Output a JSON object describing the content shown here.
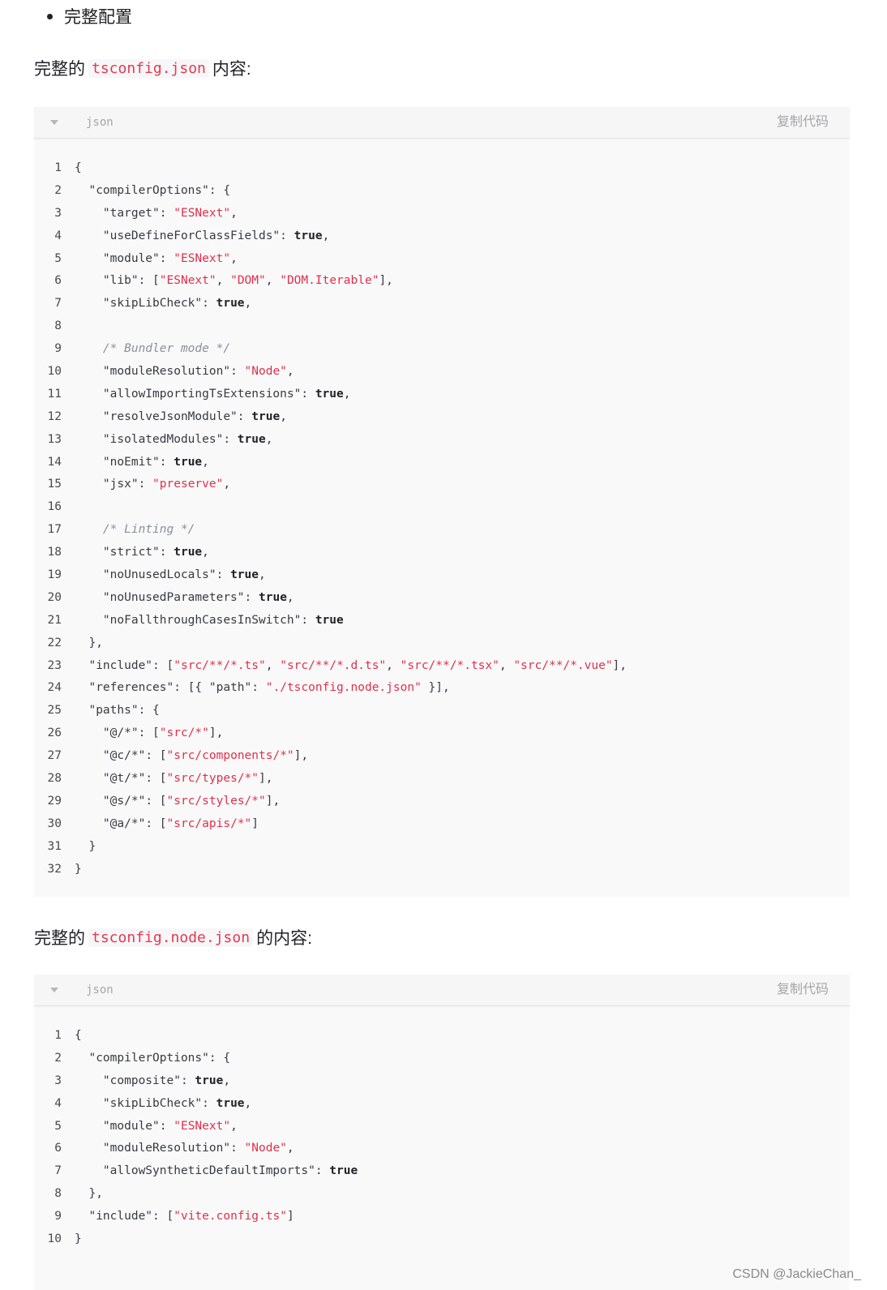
{
  "bullet": "完整配置",
  "section1": {
    "prefix": "完整的",
    "code": "tsconfig.json",
    "suffix": "内容:"
  },
  "section2": {
    "prefix": "完整的",
    "code": "tsconfig.node.json",
    "suffix": "的内容:"
  },
  "block1": {
    "lang": "json",
    "copy_label": "复制代码",
    "lines": [
      [
        [
          "p",
          "{"
        ]
      ],
      [
        [
          "p",
          "  "
        ],
        [
          "k",
          "\"compilerOptions\""
        ],
        [
          "p",
          ": {"
        ]
      ],
      [
        [
          "p",
          "    "
        ],
        [
          "k",
          "\"target\""
        ],
        [
          "p",
          ": "
        ],
        [
          "s",
          "\"ESNext\""
        ],
        [
          "p",
          ","
        ]
      ],
      [
        [
          "p",
          "    "
        ],
        [
          "k",
          "\"useDefineForClassFields\""
        ],
        [
          "p",
          ": "
        ],
        [
          "b",
          "true"
        ],
        [
          "p",
          ","
        ]
      ],
      [
        [
          "p",
          "    "
        ],
        [
          "k",
          "\"module\""
        ],
        [
          "p",
          ": "
        ],
        [
          "s",
          "\"ESNext\""
        ],
        [
          "p",
          ","
        ]
      ],
      [
        [
          "p",
          "    "
        ],
        [
          "k",
          "\"lib\""
        ],
        [
          "p",
          ": ["
        ],
        [
          "s",
          "\"ESNext\""
        ],
        [
          "p",
          ", "
        ],
        [
          "s",
          "\"DOM\""
        ],
        [
          "p",
          ", "
        ],
        [
          "s",
          "\"DOM.Iterable\""
        ],
        [
          "p",
          "],"
        ]
      ],
      [
        [
          "p",
          "    "
        ],
        [
          "k",
          "\"skipLibCheck\""
        ],
        [
          "p",
          ": "
        ],
        [
          "b",
          "true"
        ],
        [
          "p",
          ","
        ]
      ],
      [
        [
          "p",
          ""
        ]
      ],
      [
        [
          "p",
          "    "
        ],
        [
          "c",
          "/* Bundler mode */"
        ]
      ],
      [
        [
          "p",
          "    "
        ],
        [
          "k",
          "\"moduleResolution\""
        ],
        [
          "p",
          ": "
        ],
        [
          "s",
          "\"Node\""
        ],
        [
          "p",
          ","
        ]
      ],
      [
        [
          "p",
          "    "
        ],
        [
          "k",
          "\"allowImportingTsExtensions\""
        ],
        [
          "p",
          ": "
        ],
        [
          "b",
          "true"
        ],
        [
          "p",
          ","
        ]
      ],
      [
        [
          "p",
          "    "
        ],
        [
          "k",
          "\"resolveJsonModule\""
        ],
        [
          "p",
          ": "
        ],
        [
          "b",
          "true"
        ],
        [
          "p",
          ","
        ]
      ],
      [
        [
          "p",
          "    "
        ],
        [
          "k",
          "\"isolatedModules\""
        ],
        [
          "p",
          ": "
        ],
        [
          "b",
          "true"
        ],
        [
          "p",
          ","
        ]
      ],
      [
        [
          "p",
          "    "
        ],
        [
          "k",
          "\"noEmit\""
        ],
        [
          "p",
          ": "
        ],
        [
          "b",
          "true"
        ],
        [
          "p",
          ","
        ]
      ],
      [
        [
          "p",
          "    "
        ],
        [
          "k",
          "\"jsx\""
        ],
        [
          "p",
          ": "
        ],
        [
          "s",
          "\"preserve\""
        ],
        [
          "p",
          ","
        ]
      ],
      [
        [
          "p",
          ""
        ]
      ],
      [
        [
          "p",
          "    "
        ],
        [
          "c",
          "/* Linting */"
        ]
      ],
      [
        [
          "p",
          "    "
        ],
        [
          "k",
          "\"strict\""
        ],
        [
          "p",
          ": "
        ],
        [
          "b",
          "true"
        ],
        [
          "p",
          ","
        ]
      ],
      [
        [
          "p",
          "    "
        ],
        [
          "k",
          "\"noUnusedLocals\""
        ],
        [
          "p",
          ": "
        ],
        [
          "b",
          "true"
        ],
        [
          "p",
          ","
        ]
      ],
      [
        [
          "p",
          "    "
        ],
        [
          "k",
          "\"noUnusedParameters\""
        ],
        [
          "p",
          ": "
        ],
        [
          "b",
          "true"
        ],
        [
          "p",
          ","
        ]
      ],
      [
        [
          "p",
          "    "
        ],
        [
          "k",
          "\"noFallthroughCasesInSwitch\""
        ],
        [
          "p",
          ": "
        ],
        [
          "b",
          "true"
        ]
      ],
      [
        [
          "p",
          "  },"
        ]
      ],
      [
        [
          "p",
          "  "
        ],
        [
          "k",
          "\"include\""
        ],
        [
          "p",
          ": ["
        ],
        [
          "s",
          "\"src/**/*.ts\""
        ],
        [
          "p",
          ", "
        ],
        [
          "s",
          "\"src/**/*.d.ts\""
        ],
        [
          "p",
          ", "
        ],
        [
          "s",
          "\"src/**/*.tsx\""
        ],
        [
          "p",
          ", "
        ],
        [
          "s",
          "\"src/**/*.vue\""
        ],
        [
          "p",
          "],"
        ]
      ],
      [
        [
          "p",
          "  "
        ],
        [
          "k",
          "\"references\""
        ],
        [
          "p",
          ": [{ "
        ],
        [
          "k",
          "\"path\""
        ],
        [
          "p",
          ": "
        ],
        [
          "s",
          "\"./tsconfig.node.json\""
        ],
        [
          "p",
          " }],"
        ]
      ],
      [
        [
          "p",
          "  "
        ],
        [
          "k",
          "\"paths\""
        ],
        [
          "p",
          ": {"
        ]
      ],
      [
        [
          "p",
          "    "
        ],
        [
          "k",
          "\"@/*\""
        ],
        [
          "p",
          ": ["
        ],
        [
          "s",
          "\"src/*\""
        ],
        [
          "p",
          "],"
        ]
      ],
      [
        [
          "p",
          "    "
        ],
        [
          "k",
          "\"@c/*\""
        ],
        [
          "p",
          ": ["
        ],
        [
          "s",
          "\"src/components/*\""
        ],
        [
          "p",
          "],"
        ]
      ],
      [
        [
          "p",
          "    "
        ],
        [
          "k",
          "\"@t/*\""
        ],
        [
          "p",
          ": ["
        ],
        [
          "s",
          "\"src/types/*\""
        ],
        [
          "p",
          "],"
        ]
      ],
      [
        [
          "p",
          "    "
        ],
        [
          "k",
          "\"@s/*\""
        ],
        [
          "p",
          ": ["
        ],
        [
          "s",
          "\"src/styles/*\""
        ],
        [
          "p",
          "],"
        ]
      ],
      [
        [
          "p",
          "    "
        ],
        [
          "k",
          "\"@a/*\""
        ],
        [
          "p",
          ": ["
        ],
        [
          "s",
          "\"src/apis/*\""
        ],
        [
          "p",
          "]"
        ]
      ],
      [
        [
          "p",
          "  }"
        ]
      ],
      [
        [
          "p",
          "}"
        ]
      ]
    ]
  },
  "block2": {
    "lang": "json",
    "copy_label": "复制代码",
    "lines": [
      [
        [
          "p",
          "{"
        ]
      ],
      [
        [
          "p",
          "  "
        ],
        [
          "k",
          "\"compilerOptions\""
        ],
        [
          "p",
          ": {"
        ]
      ],
      [
        [
          "p",
          "    "
        ],
        [
          "k",
          "\"composite\""
        ],
        [
          "p",
          ": "
        ],
        [
          "b",
          "true"
        ],
        [
          "p",
          ","
        ]
      ],
      [
        [
          "p",
          "    "
        ],
        [
          "k",
          "\"skipLibCheck\""
        ],
        [
          "p",
          ": "
        ],
        [
          "b",
          "true"
        ],
        [
          "p",
          ","
        ]
      ],
      [
        [
          "p",
          "    "
        ],
        [
          "k",
          "\"module\""
        ],
        [
          "p",
          ": "
        ],
        [
          "s",
          "\"ESNext\""
        ],
        [
          "p",
          ","
        ]
      ],
      [
        [
          "p",
          "    "
        ],
        [
          "k",
          "\"moduleResolution\""
        ],
        [
          "p",
          ": "
        ],
        [
          "s",
          "\"Node\""
        ],
        [
          "p",
          ","
        ]
      ],
      [
        [
          "p",
          "    "
        ],
        [
          "k",
          "\"allowSyntheticDefaultImports\""
        ],
        [
          "p",
          ": "
        ],
        [
          "b",
          "true"
        ]
      ],
      [
        [
          "p",
          "  },"
        ]
      ],
      [
        [
          "p",
          "  "
        ],
        [
          "k",
          "\"include\""
        ],
        [
          "p",
          ": ["
        ],
        [
          "s",
          "\"vite.config.ts\""
        ],
        [
          "p",
          "]"
        ]
      ],
      [
        [
          "p",
          "}"
        ]
      ]
    ]
  },
  "watermark": "CSDN @JackieChan_",
  "colors": {
    "string": "#e0304a",
    "inline_code": "#e8384f",
    "comment": "#8a8f98",
    "code_bg": "#f9f9fa"
  }
}
